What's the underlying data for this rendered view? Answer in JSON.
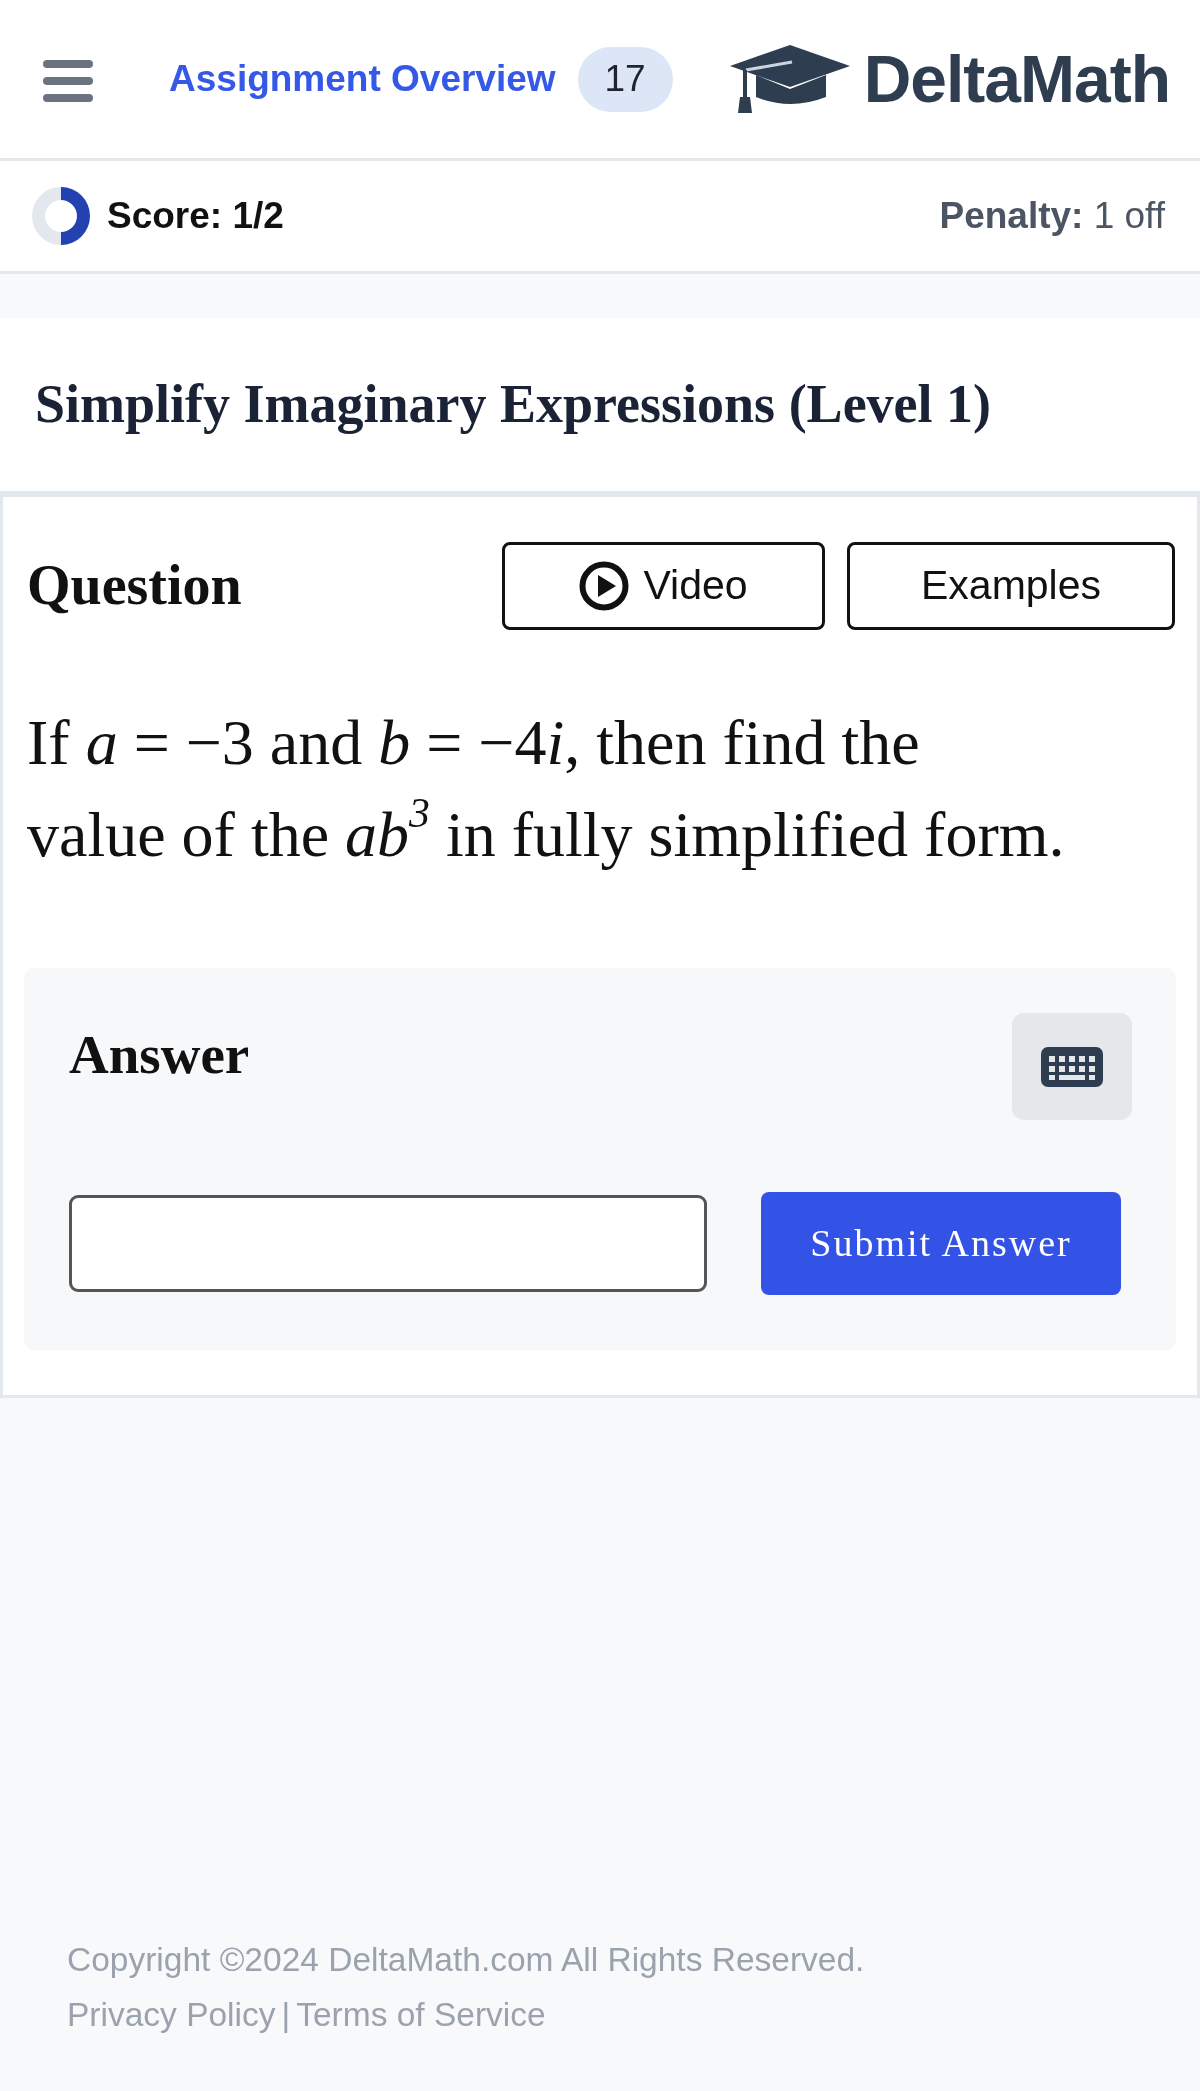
{
  "header": {
    "link": "Assignment Overview",
    "badge": "17",
    "logo": "DeltaMath"
  },
  "score_bar": {
    "score": "Score: 1/2",
    "level": 0.5,
    "penalty": "**Penalty:** 1 off"
  },
  "assignment": {
    "title": "Simplify Imaginary Expressions (Level 1)"
  },
  "question": {
    "heading": "Question",
    "buttons": [
      {
        "kind": "video",
        "label": "Video"
      },
      {
        "kind": "examples",
        "label": "Examples"
      }
    ],
    "text": [
      {
        "kind": "plain",
        "text": "If "
      },
      {
        "kind": "variable",
        "text": "a"
      },
      {
        "kind": "plain",
        "text": " = −3 and "
      },
      {
        "kind": "variable",
        "text": "b"
      },
      {
        "kind": "plain",
        "text": " = −4"
      },
      {
        "kind": "variable",
        "text": "i"
      },
      {
        "kind": "plain",
        "text": ", then find the value of the "
      },
      {
        "kind": "variable",
        "text": "ab$^{3}$"
      },
      {
        "kind": "plain",
        "text": " in fully simplified form."
      }
    ]
  },
  "answer": {
    "heading": "Answer",
    "submit": "Submit Answer"
  },
  "footer": {
    "copyright": "Copyright ©2024 DeltaMath.com All Rights Reserved.",
    "links": [
      "Privacy Policy",
      "Terms of Service"
    ],
    "separator": "|"
  }
}
